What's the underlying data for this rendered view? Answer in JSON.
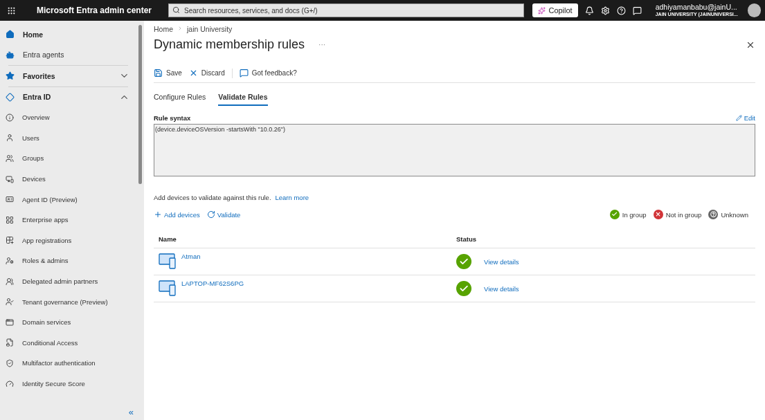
{
  "header": {
    "brand": "Microsoft Entra admin center",
    "search": {
      "placeholder": "Search resources, services, and docs (G+/)"
    },
    "copilot": "Copilot",
    "user": {
      "name": "adhiyamanbabu@jainU...",
      "org": "JAIN UNIVERSITY (JAINUNIVERSI..."
    }
  },
  "sidebar": {
    "items": [
      {
        "kind": "top",
        "label": "Home",
        "bold": true
      },
      {
        "kind": "top",
        "label": "Entra agents",
        "bold": false
      },
      {
        "kind": "section",
        "label": "Favorites",
        "expanded": false
      },
      {
        "kind": "section",
        "label": "Entra ID",
        "expanded": true
      },
      {
        "kind": "link",
        "label": "Overview"
      },
      {
        "kind": "link",
        "label": "Users"
      },
      {
        "kind": "link",
        "label": "Groups"
      },
      {
        "kind": "link",
        "label": "Devices"
      },
      {
        "kind": "link",
        "label": "Agent ID (Preview)"
      },
      {
        "kind": "link",
        "label": "Enterprise apps"
      },
      {
        "kind": "link",
        "label": "App registrations"
      },
      {
        "kind": "link",
        "label": "Roles & admins"
      },
      {
        "kind": "link",
        "label": "Delegated admin partners"
      },
      {
        "kind": "link",
        "label": "Tenant governance (Preview)"
      },
      {
        "kind": "link",
        "label": "Domain services"
      },
      {
        "kind": "link",
        "label": "Conditional Access"
      },
      {
        "kind": "link",
        "label": "Multifactor authentication"
      },
      {
        "kind": "link",
        "label": "Identity Secure Score"
      }
    ],
    "collapse": "«"
  },
  "breadcrumb": [
    "Home",
    "jain University"
  ],
  "title": "Dynamic membership rules",
  "more": "···",
  "toolbar": [
    {
      "kind": "save",
      "label": "Save"
    },
    {
      "kind": "discard",
      "label": "Discard"
    },
    {
      "kind": "feedback",
      "label": "Got feedback?"
    }
  ],
  "tabs": [
    {
      "label": "Configure Rules",
      "selected": false
    },
    {
      "label": "Validate Rules",
      "selected": true
    }
  ],
  "rule": {
    "label": "Rule syntax",
    "edit": "Edit",
    "value": "(device.deviceOSVersion -startsWith \"10.0.26\")"
  },
  "help": {
    "text": "Add devices to validate against this rule.",
    "link": "Learn more"
  },
  "actions": [
    {
      "kind": "add",
      "label": "Add devices"
    },
    {
      "kind": "validate",
      "label": "Validate"
    }
  ],
  "legend": [
    {
      "kind": "in",
      "label": "In group"
    },
    {
      "kind": "out",
      "label": "Not in group"
    },
    {
      "kind": "unknown",
      "label": "Unknown"
    }
  ],
  "table": {
    "columns": [
      "Name",
      "Status"
    ],
    "rows": [
      {
        "name": "Atman",
        "in_group": true,
        "details": "View details"
      },
      {
        "name": "LAPTOP-MF62S6PG",
        "in_group": true,
        "details": "View details"
      }
    ]
  }
}
